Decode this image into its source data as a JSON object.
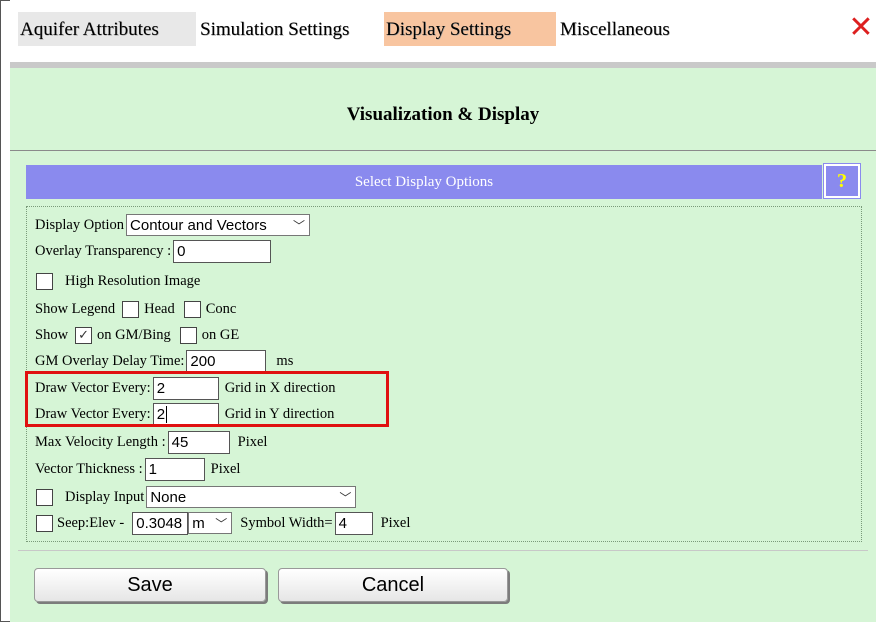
{
  "tabs": [
    {
      "label": "Aquifer Attributes"
    },
    {
      "label": "Simulation Settings"
    },
    {
      "label": "Display Settings",
      "active": true
    },
    {
      "label": "Miscellaneous"
    }
  ],
  "close": {
    "icon": "close-icon",
    "glyph": "✕",
    "color": "#dd1f1f"
  },
  "panel": {
    "title": "Visualization & Display",
    "header": "Select Display Options",
    "help_label": "?",
    "background": "#d6f5d6",
    "header_color": "#8a8aee"
  },
  "form": {
    "display_option": {
      "label": "Display Option",
      "value": "Contour and Vectors"
    },
    "overlay_transparency": {
      "label": "Overlay Transparency :",
      "value": "0"
    },
    "high_res": {
      "label": "High Resolution Image",
      "checked": false
    },
    "show_legend": {
      "label": "Show Legend",
      "head_label": "Head",
      "conc_label": "Conc"
    },
    "show": {
      "label": "Show",
      "gm_label": "on GM/Bing",
      "gm_checked": true,
      "ge_label": "on GE",
      "ge_checked": false
    },
    "gm_delay": {
      "label": "GM Overlay Delay Time:",
      "value": "200",
      "unit": "ms"
    },
    "vector_x": {
      "label": "Draw Vector Every:",
      "value": "2",
      "suffix": "Grid in X direction"
    },
    "vector_y": {
      "label": "Draw Vector Every:",
      "value": "2",
      "suffix": "Grid in Y direction"
    },
    "max_velocity": {
      "label": "Max Velocity Length :",
      "value": "45",
      "unit": "Pixel"
    },
    "vector_thickness": {
      "label": "Vector Thickness :",
      "value": "1",
      "unit": "Pixel"
    },
    "display_input": {
      "label": "Display Input",
      "value": "None"
    },
    "seep": {
      "label": "Seep:Elev -",
      "value": "0.3048",
      "unit_select": "m",
      "symbol_label": "Symbol Width=",
      "symbol_value": "4",
      "unit": "Pixel"
    }
  },
  "buttons": {
    "save": "Save",
    "cancel": "Cancel"
  },
  "highlight_color": "#e01010"
}
